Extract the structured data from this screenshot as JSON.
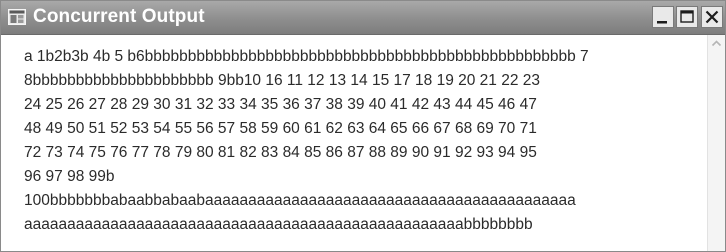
{
  "window": {
    "title": "Concurrent Output",
    "icon": "app-window-icon",
    "controls": {
      "minimize": "minimize-icon",
      "maximize": "maximize-icon",
      "close": "close-icon"
    }
  },
  "output": {
    "lines": [
      "a 1b2b3b 4b 5 b6bbbbbbbbbbbbbbbbbbbbbbbbbbbbbbbbbbbbbbbbbbbbbbbbbb 7",
      "8bbbbbbbbbbbbbbbbbbbbb 9bb10 16 11 12 13 14 15 17 18 19 20 21 22 23",
      "24 25 26 27 28 29 30 31 32 33 34 35 36 37 38 39 40 41 42 43 44 45 46 47",
      "48 49 50 51 52 53 54 55 56 57 58 59 60 61 62 63 64 65 66 67 68 69 70 71",
      "72 73 74 75 76 77 78 79 80 81 82 83 84 85 86 87 88 89 90 91 92 93 94 95",
      "96 97 98 99b",
      "100bbbbbbbabaabbabaabaaaaaaaaaaaaaaaaaaaaaaaaaaaaaaaaaaaaaaaaaaa",
      "aaaaaaaaaaaaaaaaaaaaaaaaaaaaaaaaaaaaaaaaaaaaaaaaaaabbbbbbbb"
    ]
  },
  "scrollbar": {
    "up_arrow": "chevron-up-icon"
  }
}
